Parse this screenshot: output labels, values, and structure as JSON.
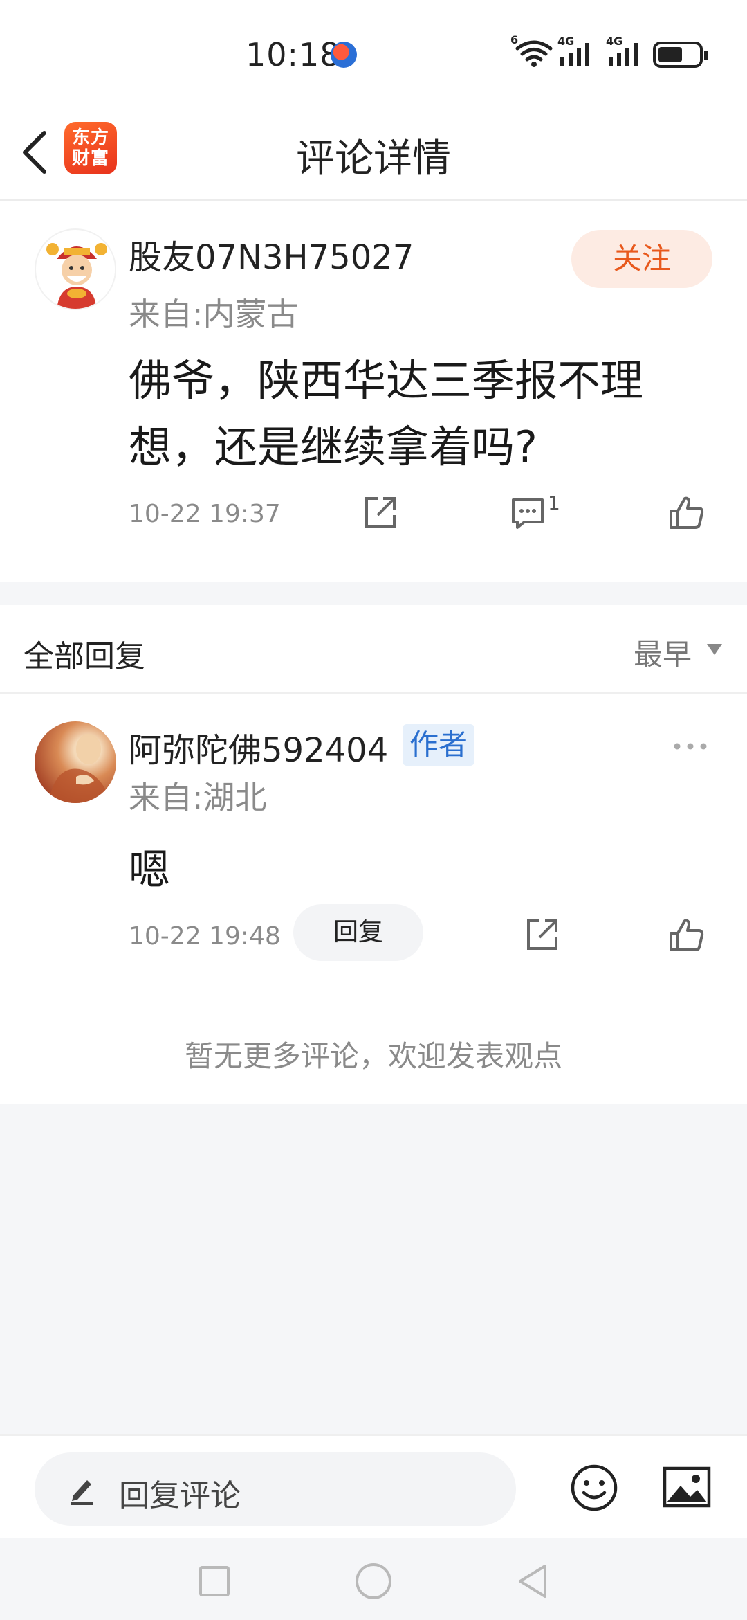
{
  "status_bar": {
    "time": "10:18",
    "wifi_badge": "6",
    "signal1_label": "4G",
    "signal2_label": "4G",
    "icons": [
      "app-notification-icon",
      "wifi-icon",
      "signal-icon",
      "signal-icon",
      "battery-icon"
    ]
  },
  "header": {
    "logo_line1": "东方",
    "logo_line2": "财富",
    "title": "评论详情"
  },
  "main_comment": {
    "username": "股友07N3H75027",
    "location": "来自:内蒙古",
    "follow_label": "关注",
    "content": "佛爷，陕西华达三季报不理想，还是继续拿着吗?",
    "timestamp": "10-22 19:37",
    "comment_count": "1"
  },
  "replies": {
    "title": "全部回复",
    "sort_label": "最早",
    "items": [
      {
        "username": "阿弥陀佛592404",
        "tag": "作者",
        "location": "来自:湖北",
        "content": "嗯",
        "timestamp": "10-22 19:48",
        "reply_label": "回复"
      }
    ],
    "no_more_text": "暂无更多评论，欢迎发表观点"
  },
  "bottom_bar": {
    "input_placeholder": "回复评论"
  },
  "colors": {
    "accent": "#e8581c",
    "follow_bg": "#fdebe3",
    "author_tag_bg": "#e6f0fb",
    "author_tag_text": "#2a6fcf",
    "page_bg": "#f5f6f8"
  }
}
